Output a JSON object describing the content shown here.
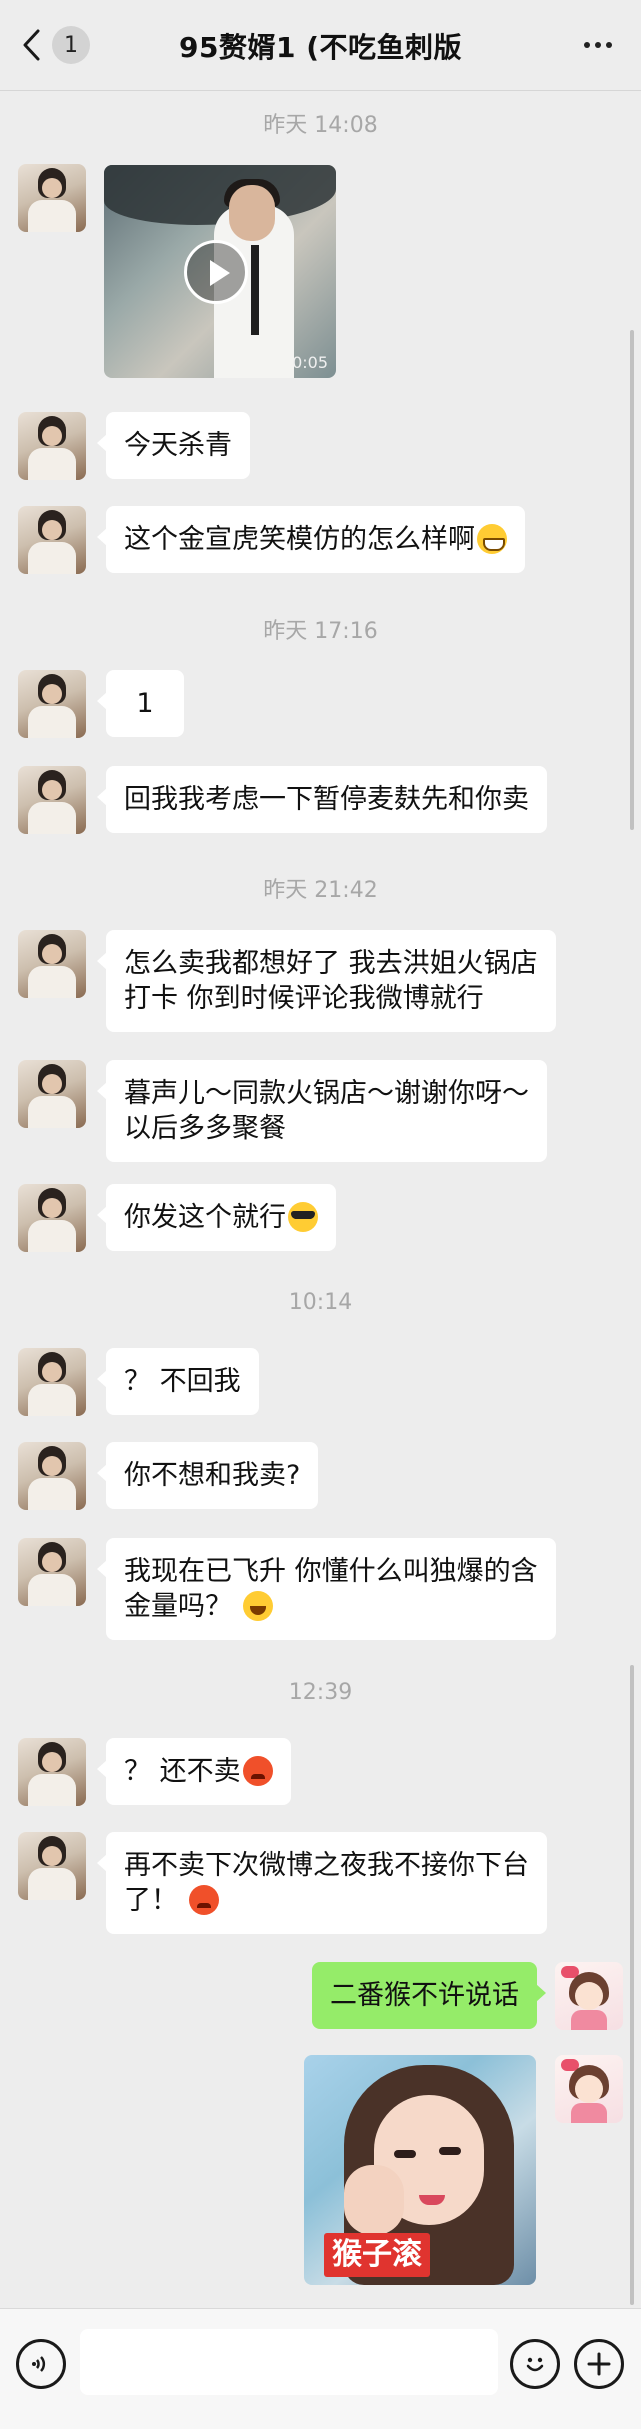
{
  "header": {
    "back_badge": "1",
    "title": "95赘婿1 (不吃鱼刺版"
  },
  "timestamps": [
    "昨天 14:08",
    "昨天 17:16",
    "昨天 21:42",
    "10:14",
    "12:39"
  ],
  "video": {
    "duration": "0:05"
  },
  "messages": {
    "m1": "今天杀青",
    "m2": "这个金宣虎笑模仿的怎么样啊",
    "m3": "1",
    "m4": "回我我考虑一下暂停麦麸先和你卖",
    "m5_l1": "怎么卖我都想好了 我去洪姐火锅店",
    "m5_l2": "打卡 你到时候评论我微博就行",
    "m6_l1": "暮声儿～同款火锅店～谢谢你呀～",
    "m6_l2": "以后多多聚餐",
    "m7": "你发这个就行",
    "m8": "？ 不回我",
    "m9": "你不想和我卖?",
    "m10_l1": "我现在已飞升 你懂什么叫独爆的含",
    "m10_l2": "金量吗？",
    "m11": "？ 还不卖",
    "m12_l1": "再不卖下次微博之夜我不接你下台",
    "m12_l2": "了！",
    "m13": "二番猴不许说话"
  },
  "photo": {
    "caption": "猴子滚"
  },
  "emoji_names": [
    "grin-emoji",
    "cool-emoji",
    "laugh-emoji",
    "angry-emoji"
  ],
  "colors": {
    "sent_bubble": "#95ec69",
    "received_bubble": "#ffffff",
    "background": "#ededed"
  }
}
